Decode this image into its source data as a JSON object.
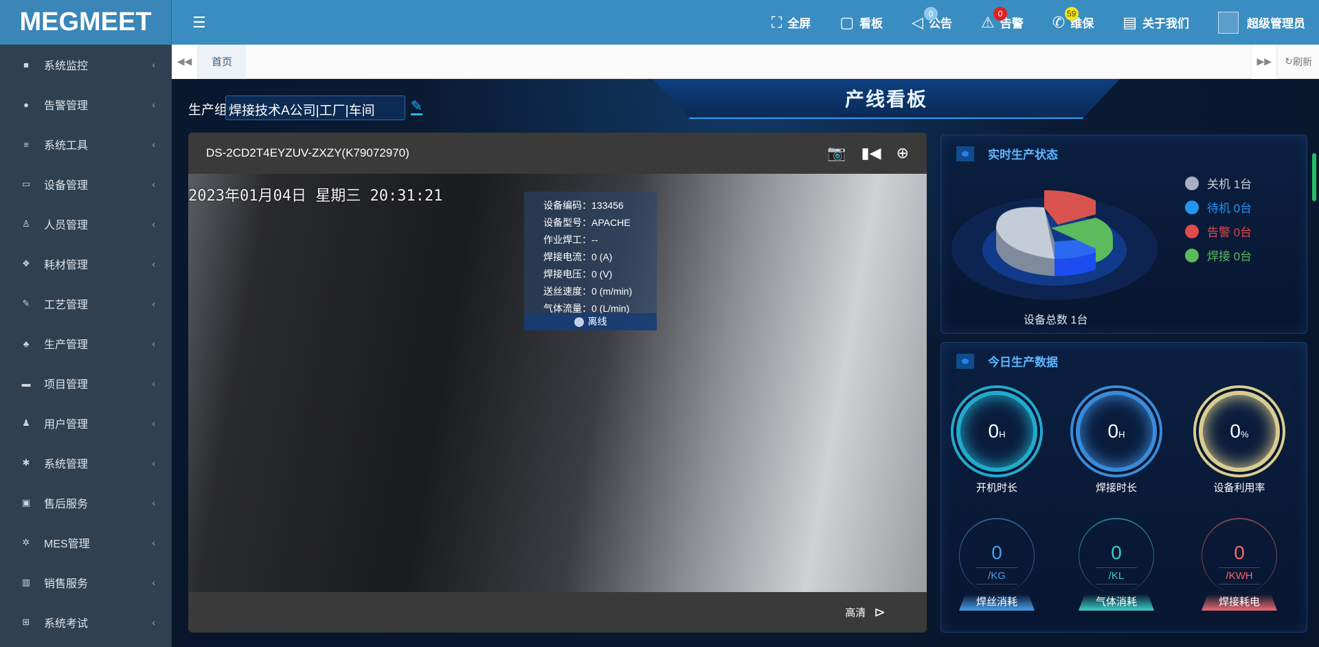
{
  "brand": "MEGMEET",
  "sidebar": {
    "items": [
      {
        "label": "系统监控",
        "icon": "video-icon",
        "glyph": "■"
      },
      {
        "label": "告警管理",
        "icon": "alert-icon",
        "glyph": "●"
      },
      {
        "label": "系统工具",
        "icon": "list-icon",
        "glyph": "≡"
      },
      {
        "label": "设备管理",
        "icon": "laptop-icon",
        "glyph": "▭"
      },
      {
        "label": "人员管理",
        "icon": "user-icon",
        "glyph": "♙"
      },
      {
        "label": "耗材管理",
        "icon": "cubes-icon",
        "glyph": "❖"
      },
      {
        "label": "工艺管理",
        "icon": "wrench-icon",
        "glyph": "✎"
      },
      {
        "label": "生产管理",
        "icon": "tree-icon",
        "glyph": "♣"
      },
      {
        "label": "项目管理",
        "icon": "folder-icon",
        "glyph": "▬"
      },
      {
        "label": "用户管理",
        "icon": "person-icon",
        "glyph": "♟"
      },
      {
        "label": "系统管理",
        "icon": "gear-icon",
        "glyph": "✱"
      },
      {
        "label": "售后服务",
        "icon": "briefcase-icon",
        "glyph": "▣"
      },
      {
        "label": "MES管理",
        "icon": "gears-icon",
        "glyph": "✲"
      },
      {
        "label": "销售服务",
        "icon": "bank-icon",
        "glyph": "▥"
      },
      {
        "label": "系统考试",
        "icon": "sitemap-icon",
        "glyph": "⊞"
      }
    ]
  },
  "header": {
    "items": [
      {
        "label": "全屏",
        "icon": "fullscreen-icon",
        "glyph": "⛶"
      },
      {
        "label": "看板",
        "icon": "dashboard-icon",
        "glyph": "▢"
      },
      {
        "label": "公告",
        "icon": "announcement-icon",
        "glyph": "◁",
        "badge": "0",
        "badge_color": "#8ec8f0"
      },
      {
        "label": "告警",
        "icon": "warning-icon",
        "glyph": "⚠",
        "badge": "0",
        "badge_color": "#e02020"
      },
      {
        "label": "维保",
        "icon": "maintenance-icon",
        "glyph": "✆",
        "badge": "59",
        "badge_color": "#f5e80a"
      },
      {
        "label": "关于我们",
        "icon": "document-icon",
        "glyph": "▤"
      }
    ],
    "user": "超级管理员"
  },
  "tabs": {
    "home": "首页",
    "refresh": "刷新"
  },
  "board": {
    "title": "产线看板",
    "org_label": "生产组织",
    "org_value": "焊接技术A公司|工厂|车间"
  },
  "video": {
    "title": "DS-2CD2T4EYZUV-ZXZY(K79072970)",
    "timestamp": "2023年01月04日  星期三  20:31:21",
    "quality": "高清",
    "info": [
      "设备编码：133456",
      "设备型号：APACHE",
      "作业焊工：--",
      "焊接电流：0 (A)",
      "焊接电压：0 (V)",
      "送丝速度：0 (m/min)",
      "气体流量：0 (L/min)"
    ],
    "status": "离线"
  },
  "realtime": {
    "title": "实时生产状态",
    "total": "设备总数 1台",
    "legend": [
      {
        "label": "关机 1台",
        "color": "#a5b0c4"
      },
      {
        "label": "待机 0台",
        "color": "#2196f3"
      },
      {
        "label": "告警 0台",
        "color": "#e04b4b"
      },
      {
        "label": "焊接 0台",
        "color": "#5cbb5c"
      }
    ]
  },
  "today": {
    "title": "今日生产数据",
    "gauges": [
      {
        "value": "0",
        "unit": "H",
        "label": "开机时长",
        "color": "#22aacc"
      },
      {
        "value": "0",
        "unit": "H",
        "label": "焊接时长",
        "color": "#3a8ad8"
      },
      {
        "value": "0",
        "unit": "%",
        "label": "设备利用率",
        "color": "#d8cc90"
      }
    ],
    "consumption": [
      {
        "value": "0",
        "unit": "/KG",
        "label": "焊丝消耗",
        "color": "#4a9eea"
      },
      {
        "value": "0",
        "unit": "/KL",
        "label": "气体消耗",
        "color": "#3ad0c8"
      },
      {
        "value": "0",
        "unit": "/KWH",
        "label": "焊接耗电",
        "color": "#ee6a70"
      }
    ]
  }
}
